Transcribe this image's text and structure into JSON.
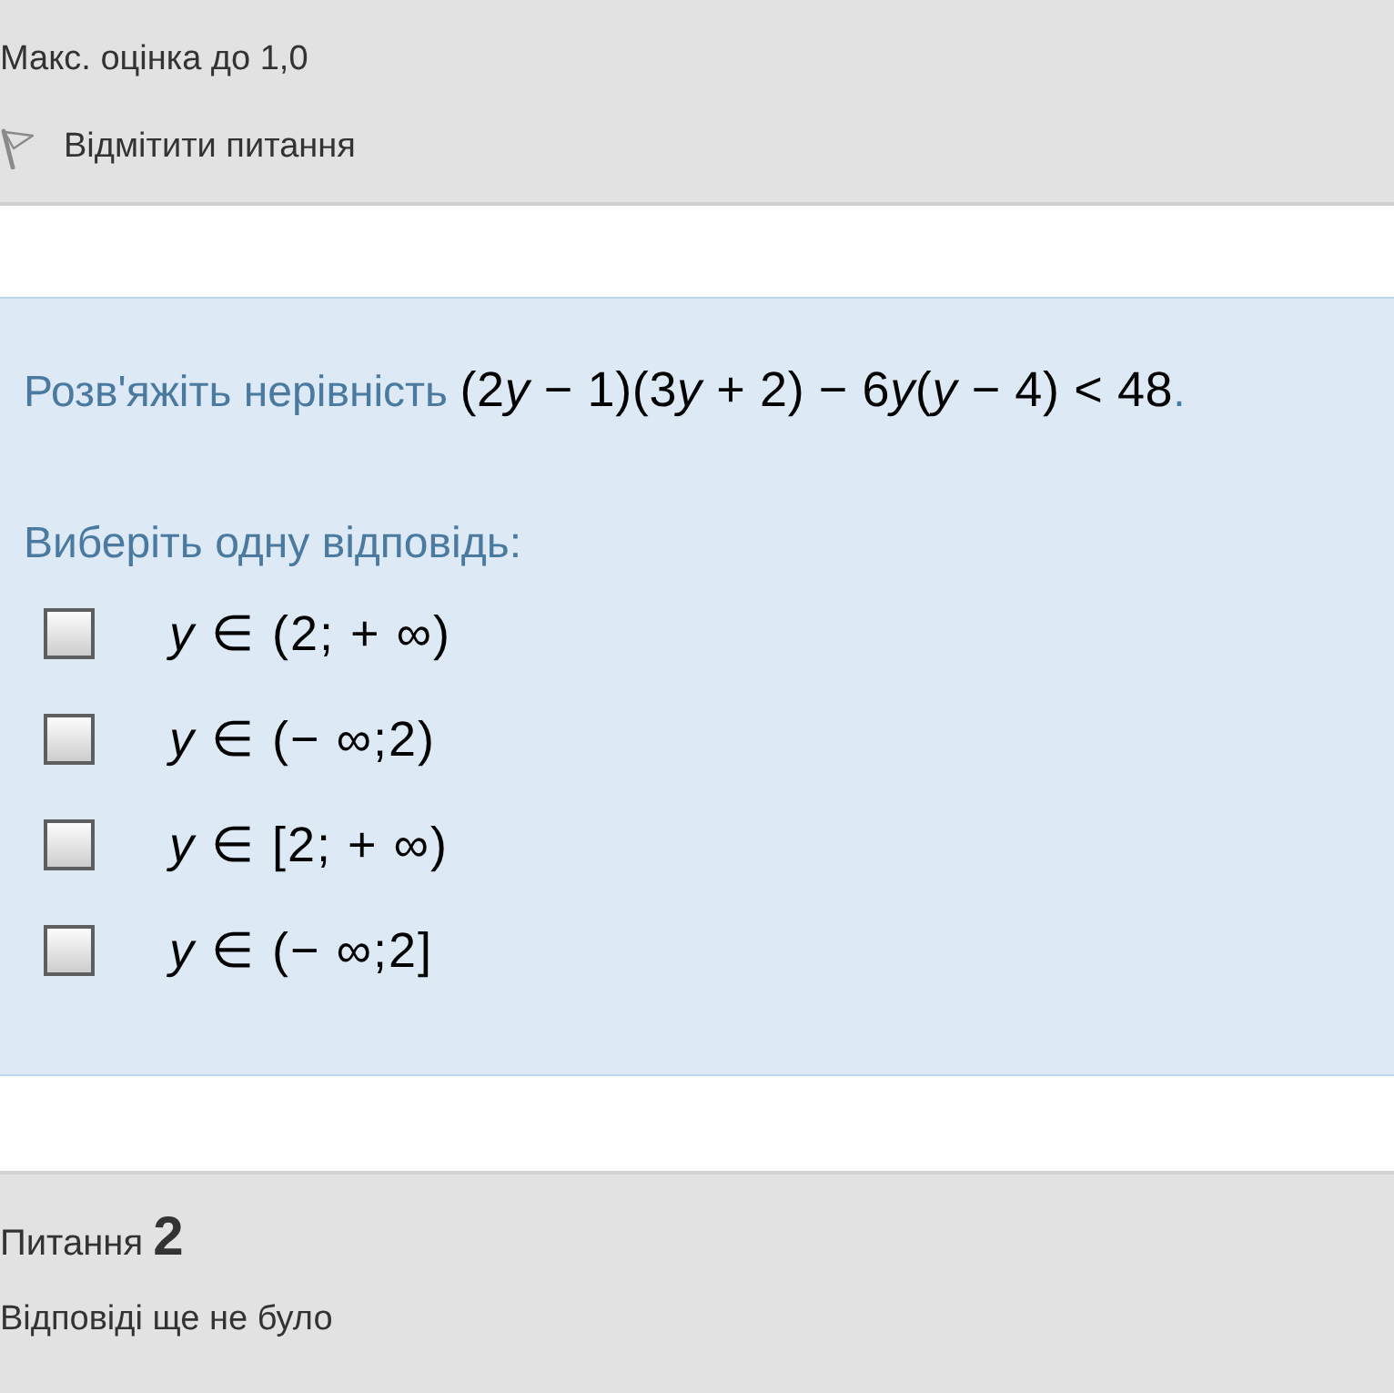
{
  "info": {
    "max_grade": "Макс. оцінка до 1,0",
    "flag_link": "Відмітити питання",
    "flagged": false
  },
  "question": {
    "text": "Розв'яжіть нерівність",
    "formula": "(2y − 1)(3y + 2) − 6y(y − 4) < 48",
    "end": ".",
    "instruction": "Виберіть одну відповідь:"
  },
  "options": [
    {
      "text": "y ∈ (2; + ∞)",
      "checked": false
    },
    {
      "text": "y ∈ (− ∞;2)",
      "checked": false
    },
    {
      "text": "y ∈ [2; + ∞)",
      "checked": false
    },
    {
      "text": "y ∈ (− ∞;2]",
      "checked": false
    }
  ],
  "next_question": {
    "label": "Питання",
    "number": "2",
    "status": "Відповіді ще не було"
  }
}
